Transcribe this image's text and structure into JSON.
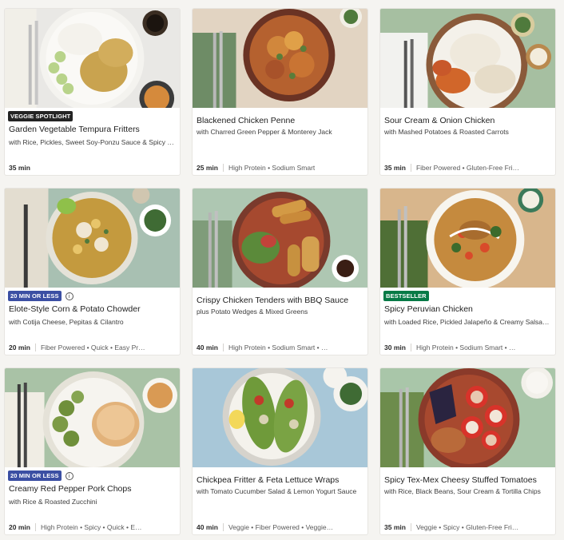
{
  "colors": {
    "tag_veggie": "#242424",
    "tag_quick": "#3b4fa3",
    "tag_bestseller": "#067a46"
  },
  "recipes": [
    {
      "tag": "VEGGIE SPOTLIGHT",
      "title": "Garden Vegetable Tempura Fritters",
      "subtitle": "with Rice, Pickles, Sweet Soy-Ponzu Sauce & Spicy …",
      "time": "35 min",
      "features": ""
    },
    {
      "tag": "",
      "title": "Blackened Chicken Penne",
      "subtitle": "with Charred Green Pepper & Monterey Jack",
      "time": "25 min",
      "features": "High Protein • Sodium Smart"
    },
    {
      "tag": "",
      "title": "Sour Cream & Onion Chicken",
      "subtitle": "with Mashed Potatoes & Roasted Carrots",
      "time": "35 min",
      "features": "Fiber Powered • Gluten-Free Fri…"
    },
    {
      "tag": "20 MIN OR LESS",
      "title": "Elote-Style Corn & Potato Chowder",
      "subtitle": "with Cotija Cheese, Pepitas & Cilantro",
      "time": "20 min",
      "features": "Fiber Powered • Quick • Easy Pr…"
    },
    {
      "tag": "",
      "title": "Crispy Chicken Tenders with BBQ Sauce",
      "subtitle": "plus Potato Wedges & Mixed Greens",
      "time": "40 min",
      "features": "High Protein • Sodium Smart • …"
    },
    {
      "tag": "BESTSELLER",
      "title": "Spicy Peruvian Chicken",
      "subtitle": "with Loaded Rice, Pickled Jalapeño & Creamy Salsa…",
      "time": "30 min",
      "features": "High Protein • Sodium Smart • …"
    },
    {
      "tag": "20 MIN OR LESS",
      "title": "Creamy Red Pepper Pork Chops",
      "subtitle": "with Rice & Roasted Zucchini",
      "time": "20 min",
      "features": "High Protein • Spicy • Quick • E…"
    },
    {
      "tag": "",
      "title": "Chickpea Fritter & Feta Lettuce Wraps",
      "subtitle": "with Tomato Cucumber Salad & Lemon Yogurt Sauce",
      "time": "40 min",
      "features": "Veggie • Fiber Powered • Veggie…"
    },
    {
      "tag": "",
      "title": "Spicy Tex-Mex Cheesy Stuffed Tomatoes",
      "subtitle": "with Rice, Black Beans, Sour Cream & Tortilla Chips",
      "time": "35 min",
      "features": "Veggie • Spicy • Gluten-Free Fri…"
    }
  ]
}
